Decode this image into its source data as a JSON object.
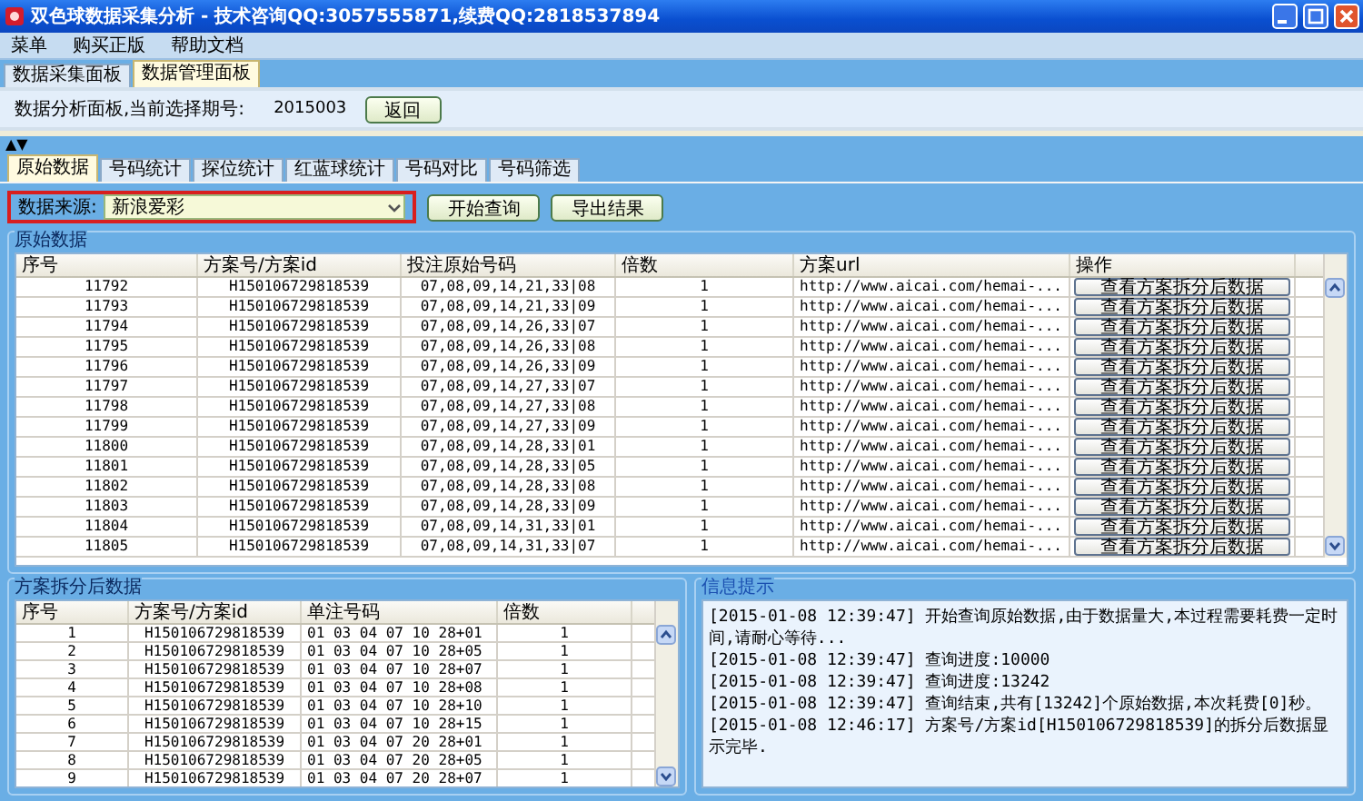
{
  "window": {
    "title": "双色球数据采集分析 - 技术咨询QQ:3057555871,续费QQ:2818537894"
  },
  "menu": [
    "菜单",
    "购买正版",
    "帮助文档"
  ],
  "panel_tabs": [
    {
      "label": "数据采集面板",
      "selected": false
    },
    {
      "label": "数据管理面板",
      "selected": true
    }
  ],
  "analysis_bar": {
    "label": "数据分析面板,当前选择期号:",
    "period": "2015003",
    "back_button": "返回"
  },
  "splitter": "▲▼",
  "data_tabs": [
    {
      "label": "原始数据",
      "selected": true
    },
    {
      "label": "号码统计",
      "selected": false
    },
    {
      "label": "探位统计",
      "selected": false
    },
    {
      "label": "红蓝球统计",
      "selected": false
    },
    {
      "label": "号码对比",
      "selected": false
    },
    {
      "label": "号码筛选",
      "selected": false
    }
  ],
  "query_bar": {
    "source_label": "数据来源:",
    "source": "新浪爱彩",
    "query_button": "开始查询",
    "export_button": "导出结果",
    "highlighted": true
  },
  "raw_data": {
    "title": "原始数据",
    "columns": [
      {
        "label": "序号",
        "kind": "text"
      },
      {
        "label": "方案号/方案id",
        "kind": "text"
      },
      {
        "label": "投注原始号码",
        "kind": "text"
      },
      {
        "label": "倍数",
        "kind": "text"
      },
      {
        "label": "方案url",
        "kind": "text"
      },
      {
        "label": "操作",
        "kind": "button"
      }
    ],
    "rows": [
      [
        "11792",
        "H150106729818539",
        "07,08,09,14,21,33|08",
        "1",
        "http://www.aicai.com/hemai-...",
        "查看方案拆分后数据"
      ],
      [
        "11793",
        "H150106729818539",
        "07,08,09,14,21,33|09",
        "1",
        "http://www.aicai.com/hemai-...",
        "查看方案拆分后数据"
      ],
      [
        "11794",
        "H150106729818539",
        "07,08,09,14,26,33|07",
        "1",
        "http://www.aicai.com/hemai-...",
        "查看方案拆分后数据"
      ],
      [
        "11795",
        "H150106729818539",
        "07,08,09,14,26,33|08",
        "1",
        "http://www.aicai.com/hemai-...",
        "查看方案拆分后数据"
      ],
      [
        "11796",
        "H150106729818539",
        "07,08,09,14,26,33|09",
        "1",
        "http://www.aicai.com/hemai-...",
        "查看方案拆分后数据"
      ],
      [
        "11797",
        "H150106729818539",
        "07,08,09,14,27,33|07",
        "1",
        "http://www.aicai.com/hemai-...",
        "查看方案拆分后数据"
      ],
      [
        "11798",
        "H150106729818539",
        "07,08,09,14,27,33|08",
        "1",
        "http://www.aicai.com/hemai-...",
        "查看方案拆分后数据"
      ],
      [
        "11799",
        "H150106729818539",
        "07,08,09,14,27,33|09",
        "1",
        "http://www.aicai.com/hemai-...",
        "查看方案拆分后数据"
      ],
      [
        "11800",
        "H150106729818539",
        "07,08,09,14,28,33|01",
        "1",
        "http://www.aicai.com/hemai-...",
        "查看方案拆分后数据"
      ],
      [
        "11801",
        "H150106729818539",
        "07,08,09,14,28,33|05",
        "1",
        "http://www.aicai.com/hemai-...",
        "查看方案拆分后数据"
      ],
      [
        "11802",
        "H150106729818539",
        "07,08,09,14,28,33|08",
        "1",
        "http://www.aicai.com/hemai-...",
        "查看方案拆分后数据"
      ],
      [
        "11803",
        "H150106729818539",
        "07,08,09,14,28,33|09",
        "1",
        "http://www.aicai.com/hemai-...",
        "查看方案拆分后数据"
      ],
      [
        "11804",
        "H150106729818539",
        "07,08,09,14,31,33|01",
        "1",
        "http://www.aicai.com/hemai-...",
        "查看方案拆分后数据"
      ],
      [
        "11805",
        "H150106729818539",
        "07,08,09,14,31,33|07",
        "1",
        "http://www.aicai.com/hemai-...",
        "查看方案拆分后数据"
      ]
    ]
  },
  "split_data": {
    "title": "方案拆分后数据",
    "columns": [
      {
        "label": "序号",
        "kind": "text"
      },
      {
        "label": "方案号/方案id",
        "kind": "text"
      },
      {
        "label": "单注号码",
        "kind": "text"
      },
      {
        "label": "倍数",
        "kind": "text"
      }
    ],
    "rows": [
      [
        "1",
        "H150106729818539",
        "01 03 04 07 10 28+01",
        "1"
      ],
      [
        "2",
        "H150106729818539",
        "01 03 04 07 10 28+05",
        "1"
      ],
      [
        "3",
        "H150106729818539",
        "01 03 04 07 10 28+07",
        "1"
      ],
      [
        "4",
        "H150106729818539",
        "01 03 04 07 10 28+08",
        "1"
      ],
      [
        "5",
        "H150106729818539",
        "01 03 04 07 10 28+10",
        "1"
      ],
      [
        "6",
        "H150106729818539",
        "01 03 04 07 10 28+15",
        "1"
      ],
      [
        "7",
        "H150106729818539",
        "01 03 04 07 20 28+01",
        "1"
      ],
      [
        "8",
        "H150106729818539",
        "01 03 04 07 20 28+05",
        "1"
      ],
      [
        "9",
        "H150106729818539",
        "01 03 04 07 20 28+07",
        "1"
      ]
    ]
  },
  "messages": {
    "title": "信息提示",
    "lines": [
      "[2015-01-08 12:39:47] 开始查询原始数据,由于数据量大,本过程需要耗费一定时间,请耐心等待...",
      "[2015-01-08 12:39:47] 查询进度:10000",
      "[2015-01-08 12:39:47] 查询进度:13242",
      "[2015-01-08 12:39:47] 查询结束,共有[13242]个原始数据,本次耗费[0]秒。",
      "[2015-01-08 12:46:17] 方案号/方案id[H150106729818539]的拆分后数据显示完毕."
    ]
  }
}
